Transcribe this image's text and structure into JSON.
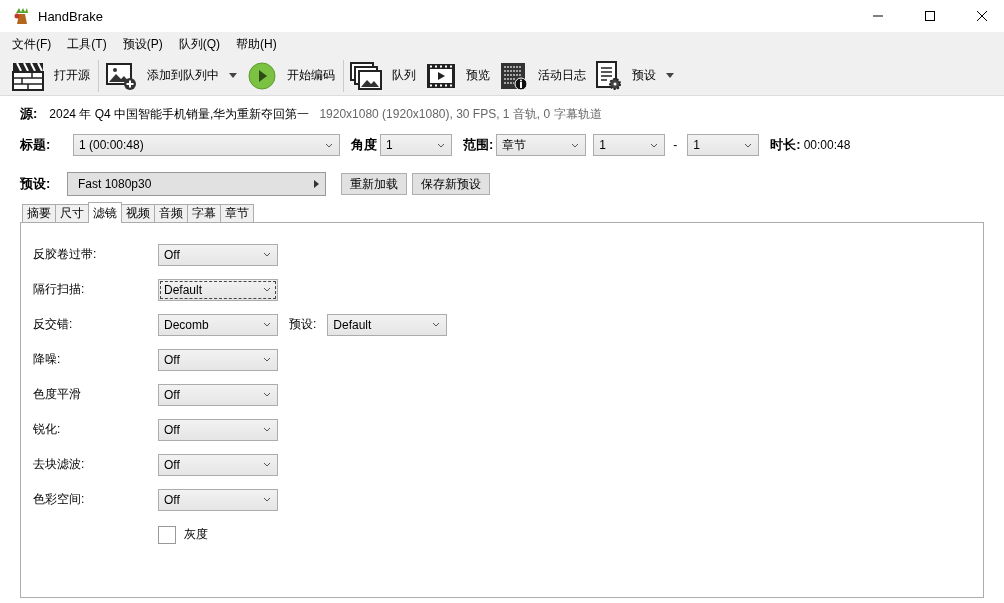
{
  "window": {
    "title": "HandBrake"
  },
  "menu": [
    "文件(F)",
    "工具(T)",
    "预设(P)",
    "队列(Q)",
    "帮助(H)"
  ],
  "toolbar": [
    [
      {
        "kind": "clapper",
        "label": "打开源",
        "dropdown": false
      }
    ],
    [
      {
        "kind": "add-image",
        "label": "添加到队列中",
        "dropdown": true
      },
      {
        "kind": "play",
        "label": "开始编码",
        "dropdown": false
      }
    ],
    [
      {
        "kind": "images",
        "label": "队列",
        "dropdown": false
      },
      {
        "kind": "film",
        "label": "预览",
        "dropdown": false
      },
      {
        "kind": "log",
        "label": "活动日志",
        "dropdown": false
      },
      {
        "kind": "doc-gear",
        "label": "预设",
        "dropdown": true
      }
    ]
  ],
  "source": {
    "label": "源:",
    "name": "2024 年 Q4 中国智能手机销量,华为重新夺回第一",
    "info": "1920x1080 (1920x1080), 30 FPS, 1 音轨, 0 字幕轨道"
  },
  "title_row": {
    "title_label": "标题:",
    "title_value": "1  (00:00:48)",
    "angle_label": "角度",
    "angle_value": "1",
    "range_label": "范围:",
    "range_kind": "章节",
    "range_start": "1",
    "range_sep": "-",
    "range_end": "1",
    "duration_label": "时长:",
    "duration": "00:00:48"
  },
  "preset_row": {
    "label": "预设:",
    "value": "Fast 1080p30",
    "buttons": [
      "重新加载",
      "保存新预设"
    ]
  },
  "tabs": [
    {
      "label": "摘要",
      "selected": false
    },
    {
      "label": "尺寸",
      "selected": false
    },
    {
      "label": "滤镜",
      "selected": true
    },
    {
      "label": "视频",
      "selected": false
    },
    {
      "label": "音频",
      "selected": false
    },
    {
      "label": "字幕",
      "selected": false
    },
    {
      "label": "章节",
      "selected": false
    }
  ],
  "filters": [
    {
      "label": "反胶卷过带:",
      "value": "Off",
      "focused": false
    },
    {
      "label": "隔行扫描:",
      "value": "Default",
      "focused": true
    },
    {
      "label": "反交错:",
      "value": "Decomb",
      "focused": false,
      "preset_label": "预设:",
      "preset_value": "Default"
    },
    {
      "label": "降噪:",
      "value": "Off",
      "focused": false
    },
    {
      "label": "色度平滑",
      "value": "Off",
      "focused": false
    },
    {
      "label": "锐化:",
      "value": "Off",
      "focused": false
    },
    {
      "label": "去块滤波:",
      "value": "Off",
      "focused": false
    },
    {
      "label": "色彩空间:",
      "value": "Off",
      "focused": false
    }
  ],
  "grayscale": {
    "label": "灰度",
    "checked": false
  }
}
